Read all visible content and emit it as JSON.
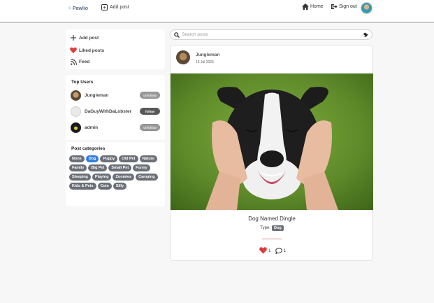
{
  "nav": {
    "brand": "Pawlio",
    "add_post": "Add post",
    "home": "Home",
    "sign_out": "Sign out"
  },
  "sidebar": {
    "items": [
      {
        "label": "Add post",
        "icon": "plus-icon"
      },
      {
        "label": "Liked posts",
        "icon": "heart-icon"
      },
      {
        "label": "Feed",
        "icon": "rss-icon"
      }
    ]
  },
  "top_users": {
    "title": "Top Users",
    "users": [
      {
        "name": "Jungleman",
        "action": "unfollow"
      },
      {
        "name": "DaGuyWithDaLobster",
        "action": "follow"
      },
      {
        "name": "admin",
        "action": "unfollow"
      }
    ]
  },
  "categories": {
    "title": "Post categories",
    "tags": [
      "None",
      "Dog",
      "Puppy",
      "Old Pet",
      "Nature",
      "Family",
      "Big Pet",
      "Small Pet",
      "Funny",
      "Sleeping",
      "Playing",
      "Zoomies",
      "Camping",
      "Kids & Pets",
      "Cute",
      "Silly"
    ],
    "active": "Dog"
  },
  "search": {
    "placeholder": "Search posts"
  },
  "post": {
    "author": "Jungleman",
    "date": "16 Jul 2025",
    "title": "Dog Named Dingle",
    "type_label": "Type:",
    "type_value": "Dog",
    "likes": "1",
    "comments": "1"
  },
  "colors": {
    "accent": "#2f7de1",
    "heart": "#e03b3b",
    "tag": "#6b6f78"
  }
}
